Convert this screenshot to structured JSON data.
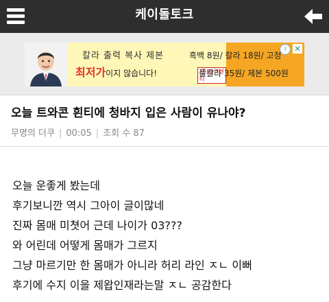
{
  "header": {
    "title": "케이돌토크",
    "menu_icon": "hamburger-menu-icon",
    "back_icon": "back-arrow-icon"
  },
  "ad": {
    "line1": "칼라 출력 복사 제본",
    "line2_red": "최저가",
    "line2_rest": "이지 않습니다!",
    "tag": "(주)출력센터",
    "price1": "흑백 8원/ 칼라 18원/ 고정",
    "price2": "풀칼라 35원/ 제본 500원",
    "info_icon": "info-icon",
    "close_icon": "close-icon"
  },
  "post": {
    "title": "오늘 트와콘 흰티에 청바지 입은 사람이 유나야?",
    "author": "무명의 더쿠",
    "time": "00:05",
    "views": "조회 수 87",
    "body": [
      "오늘 운좋게 봤는데",
      "후기보니깐 역시 그아이 글이많네",
      "진짜 몸매 미쳣어 근데 나이가 03???",
      "와 어린데 어떻게 몸매가 그르지",
      "그냥 마르기만 한 몸매가 아니라 허리 라인 ㅈㄴ 이뻐",
      "후기에 수지 이을 제왑인재라는말 ㅈㄴ 공감한다"
    ]
  },
  "colors": {
    "topbar": "#2e2e2e",
    "ad_orange": "#f5a623",
    "ad_red": "#e2312b"
  }
}
